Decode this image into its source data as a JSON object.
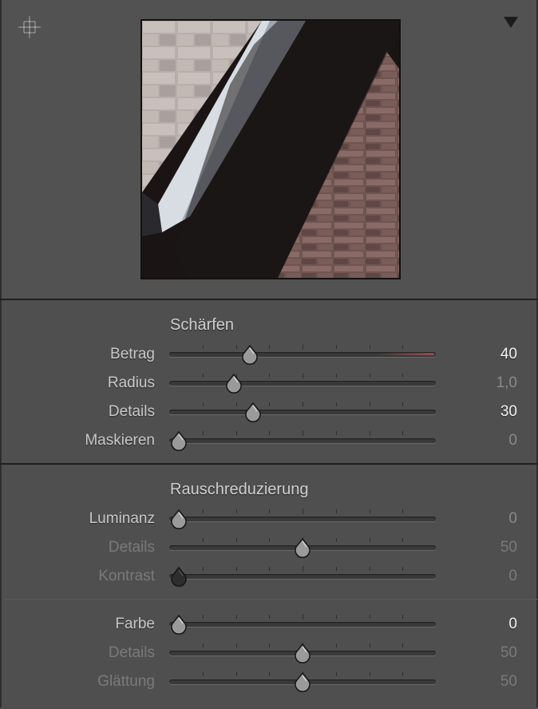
{
  "icons": {
    "target": "target-adjust-icon",
    "collapse": "triangle-down-icon"
  },
  "sharpening": {
    "title": "Schärfen",
    "rows": [
      {
        "label": "Betrag",
        "value": "40",
        "fraction": 0.2857,
        "state": "active"
      },
      {
        "label": "Radius",
        "value": "1,0",
        "fraction": 0.2222,
        "state": "mid"
      },
      {
        "label": "Details",
        "value": "30",
        "fraction": 0.3,
        "state": "active"
      },
      {
        "label": "Maskieren",
        "value": "0",
        "fraction": 0.0,
        "state": "mid"
      }
    ]
  },
  "noise_reduction": {
    "title": "Rauschreduzierung",
    "luminance_rows": [
      {
        "label": "Luminanz",
        "value": "0",
        "fraction": 0.0,
        "state": "mid"
      },
      {
        "label": "Details",
        "value": "50",
        "fraction": 0.5,
        "state": "dim"
      },
      {
        "label": "Kontrast",
        "value": "0",
        "fraction": 0.0,
        "state": "dim"
      }
    ],
    "color_rows": [
      {
        "label": "Farbe",
        "value": "0",
        "fraction": 0.0,
        "state": "active"
      },
      {
        "label": "Details",
        "value": "50",
        "fraction": 0.5,
        "state": "dim"
      },
      {
        "label": "Glättung",
        "value": "50",
        "fraction": 0.5,
        "state": "dim"
      }
    ]
  },
  "colors": {
    "panel": "#4f4f4f",
    "accent_track": "#9a4a4a"
  }
}
